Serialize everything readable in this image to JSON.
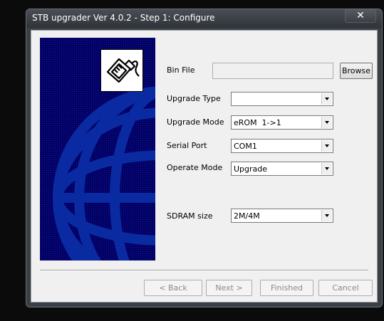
{
  "window": {
    "title": "STB upgrader Ver 4.0.2 - Step 1: Configure",
    "close_label": "✕"
  },
  "banner": {
    "icon": "usb-plug-icon",
    "colors": {
      "background": "#000066",
      "globe": "#0b2fa8"
    }
  },
  "form": {
    "bin_file": {
      "label": "Bin File",
      "value": "",
      "browse_label": "Browse"
    },
    "upgrade_type": {
      "label": "Upgrade Type",
      "value": ""
    },
    "upgrade_mode": {
      "label": "Upgrade Mode",
      "value": "eROM  1->1"
    },
    "serial_port": {
      "label": "Serial Port",
      "value": "COM1"
    },
    "operate_mode": {
      "label": "Operate Mode",
      "value": "Upgrade"
    },
    "sdram_size": {
      "label": "SDRAM size",
      "value": "2M/4M"
    }
  },
  "buttons": {
    "back": "< Back",
    "next": "Next >",
    "finished": "Finished",
    "cancel": "Cancel"
  }
}
